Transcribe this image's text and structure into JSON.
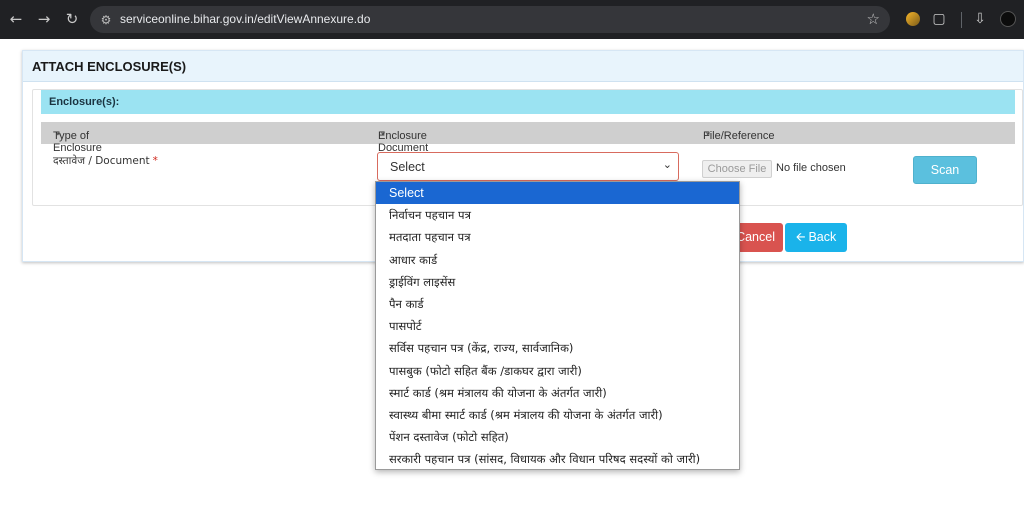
{
  "browser": {
    "url": "serviceonline.bihar.gov.in/editViewAnnexure.do"
  },
  "page": {
    "title": "ATTACH ENCLOSURE(S)",
    "section_title": "Enclosure(s):",
    "columns": {
      "type": "Type of Enclosure",
      "document": "Enclosure Document",
      "file": "File/Reference",
      "required_mark": "*"
    },
    "row": {
      "label": "दस्तावेज / Document",
      "required_mark": "*",
      "select_value": "Select",
      "choose_file": "Choose File",
      "no_file": "No file chosen",
      "scan": "Scan"
    },
    "buttons": {
      "cancel": "Cancel",
      "back": "Back"
    }
  },
  "dropdown": {
    "options": [
      "Select",
      "निर्वाचन पहचान पत्र",
      "मतदाता पहचान पत्र",
      "आधार कार्ड",
      "ड्राईविंग लाइसेंस",
      "पैन कार्ड",
      "पासपोर्ट",
      "सर्विस पहचान पत्र (केंद्र, राज्य, सार्वजानिक)",
      "पासबुक (फोटो सहित बैंक /डाकघर द्वारा जारी)",
      "स्मार्ट कार्ड (श्रम मंत्रालय की योजना के अंतर्गत जारी)",
      "स्वास्थ्य बीमा स्मार्ट कार्ड (श्रम मंत्रालय की योजना के अंतर्गत जारी)",
      "पेंशन दस्तावेज (फोटो सहित)",
      "सरकारी पहचान पत्र (सांसद, विधायक और विधान परिषद सदस्यों को जारी)"
    ],
    "selected_index": 0
  },
  "colors": {
    "chrome_bg": "#202124",
    "header_bg": "#e8f4fc",
    "section_bg": "#9be3f2",
    "scan_btn": "#5bc0de",
    "cancel_btn": "#d9534f",
    "back_btn": "#1ab3ea",
    "selected_option": "#1a67d2"
  }
}
